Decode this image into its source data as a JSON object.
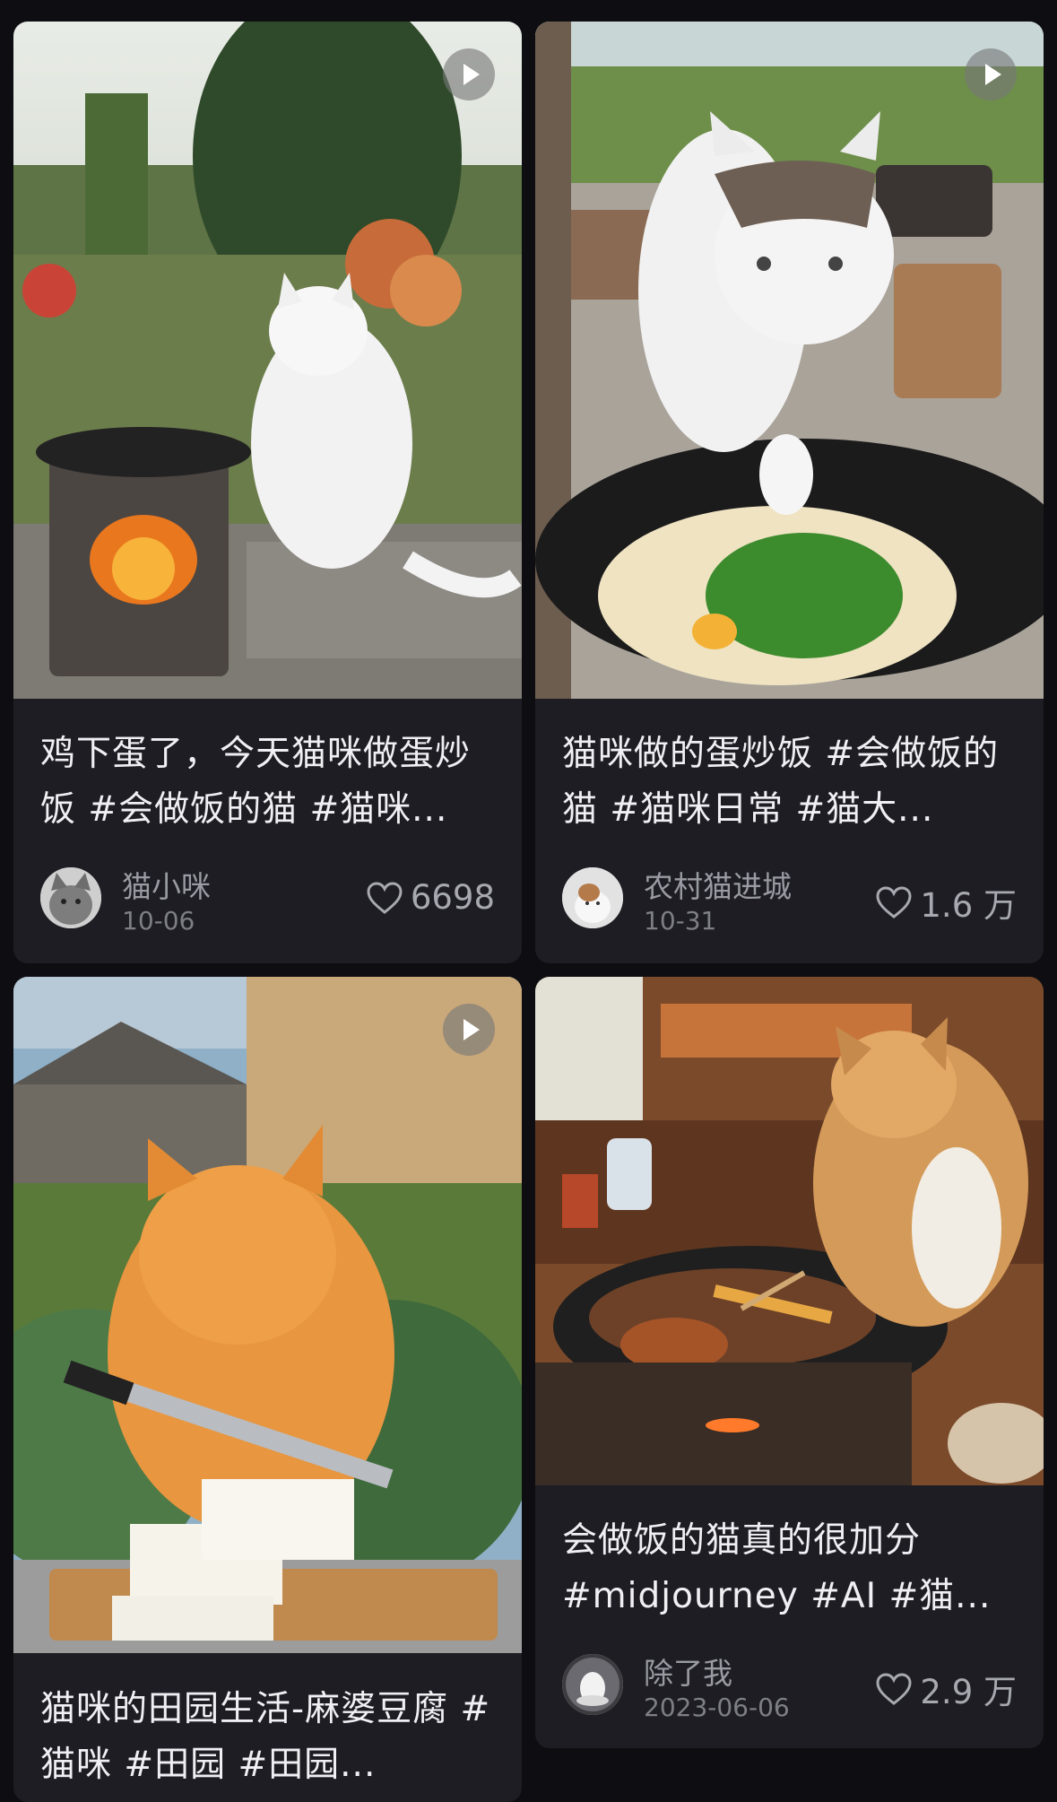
{
  "feed": {
    "cards": [
      {
        "title": "鸡下蛋了，今天猫咪做蛋炒饭 #会做饭的猫 #猫咪...",
        "author": "猫小咪",
        "date": "10-06",
        "likes": "6698"
      },
      {
        "title": "猫咪做的蛋炒饭 #会做饭的猫  #猫咪日常  #猫大...",
        "author": "农村猫进城",
        "date": "10-31",
        "likes": "1.6 万"
      },
      {
        "title": "猫咪的田园生活-麻婆豆腐 #猫咪  #田园  #田园...",
        "author": "",
        "date": "",
        "likes": ""
      },
      {
        "title": "会做饭的猫真的很加分 #midjourney  #AI  #猫...",
        "author": "除了我",
        "date": "2023-06-06",
        "likes": "2.9 万"
      }
    ]
  }
}
